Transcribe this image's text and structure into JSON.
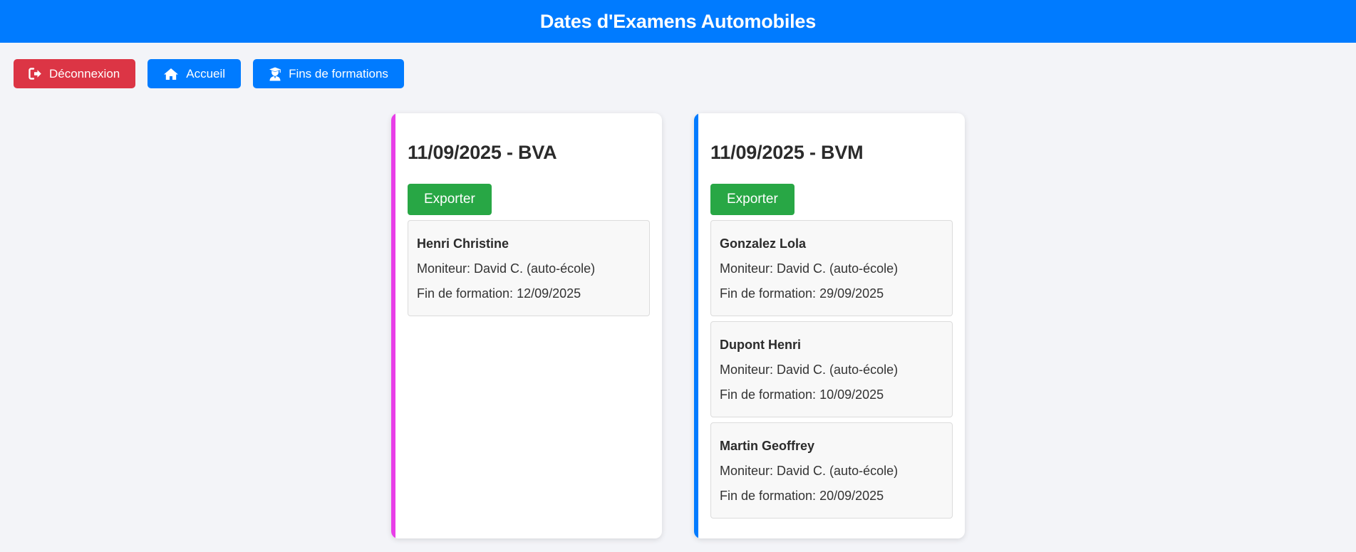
{
  "header": {
    "title": "Dates d'Examens Automobiles"
  },
  "toolbar": {
    "logout_label": "Déconnexion",
    "home_label": "Accueil",
    "trainings_label": "Fins de formations",
    "logout_color": "#dc3545",
    "primary_color": "#007bff"
  },
  "sessions": [
    {
      "title": "11/09/2025 - BVA",
      "accent_color": "#e83ee8",
      "export_label": "Exporter",
      "students": [
        {
          "name": "Henri Christine",
          "instructor": "Moniteur: David C. (auto-école)",
          "training_end": "Fin de formation: 12/09/2025"
        }
      ]
    },
    {
      "title": "11/09/2025 - BVM",
      "accent_color": "#007bff",
      "export_label": "Exporter",
      "students": [
        {
          "name": "Gonzalez Lola",
          "instructor": "Moniteur: David C. (auto-école)",
          "training_end": "Fin de formation: 29/09/2025"
        },
        {
          "name": "Dupont Henri",
          "instructor": "Moniteur: David C. (auto-école)",
          "training_end": "Fin de formation: 10/09/2025"
        },
        {
          "name": "Martin Geoffrey",
          "instructor": "Moniteur: David C. (auto-école)",
          "training_end": "Fin de formation: 20/09/2025"
        }
      ]
    }
  ]
}
